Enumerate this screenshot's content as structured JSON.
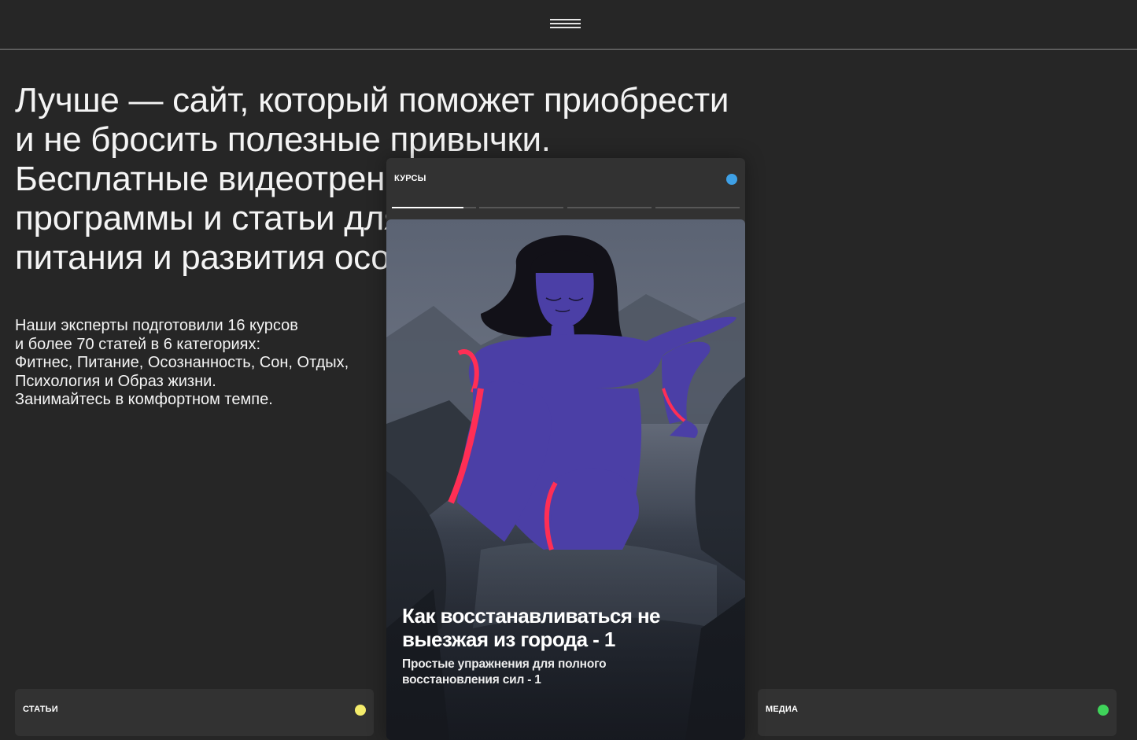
{
  "header": {
    "menu_icon": "hamburger-menu-icon"
  },
  "hero": {
    "headline_lines": [
      "Лучше — сайт, который поможет приобрести",
      "и не бросить полезные привычки.",
      "Бесплатные видеотренировки, медитации,",
      "программы и статьи для улучшения сна,",
      "питания и развития осознанности."
    ],
    "intro_lines": [
      "Наши эксперты подготовили 16 курсов",
      "и более 70 статей в 6 категориях:",
      "Фитнес, Питание, Осознанность, Сон, Отдых,",
      "Психология и Образ жизни.",
      "Занимайтесь в комфортном темпе."
    ]
  },
  "cards": {
    "articles": {
      "label": "СТАТЬИ",
      "dot_color": "#f4ec6b"
    },
    "courses": {
      "label": "КУРСЫ",
      "dot_color": "#3ea0e6",
      "story_progress": [
        0.85,
        0,
        0,
        0
      ],
      "slide": {
        "title_lines": [
          "Как восстанавливаться не",
          "выезжая из города - 1"
        ],
        "subtitle_lines": [
          "Простые упражнения для полного",
          "восстановления сил - 1"
        ]
      }
    },
    "media": {
      "label": "МЕДИА",
      "dot_color": "#3fd35a"
    }
  }
}
